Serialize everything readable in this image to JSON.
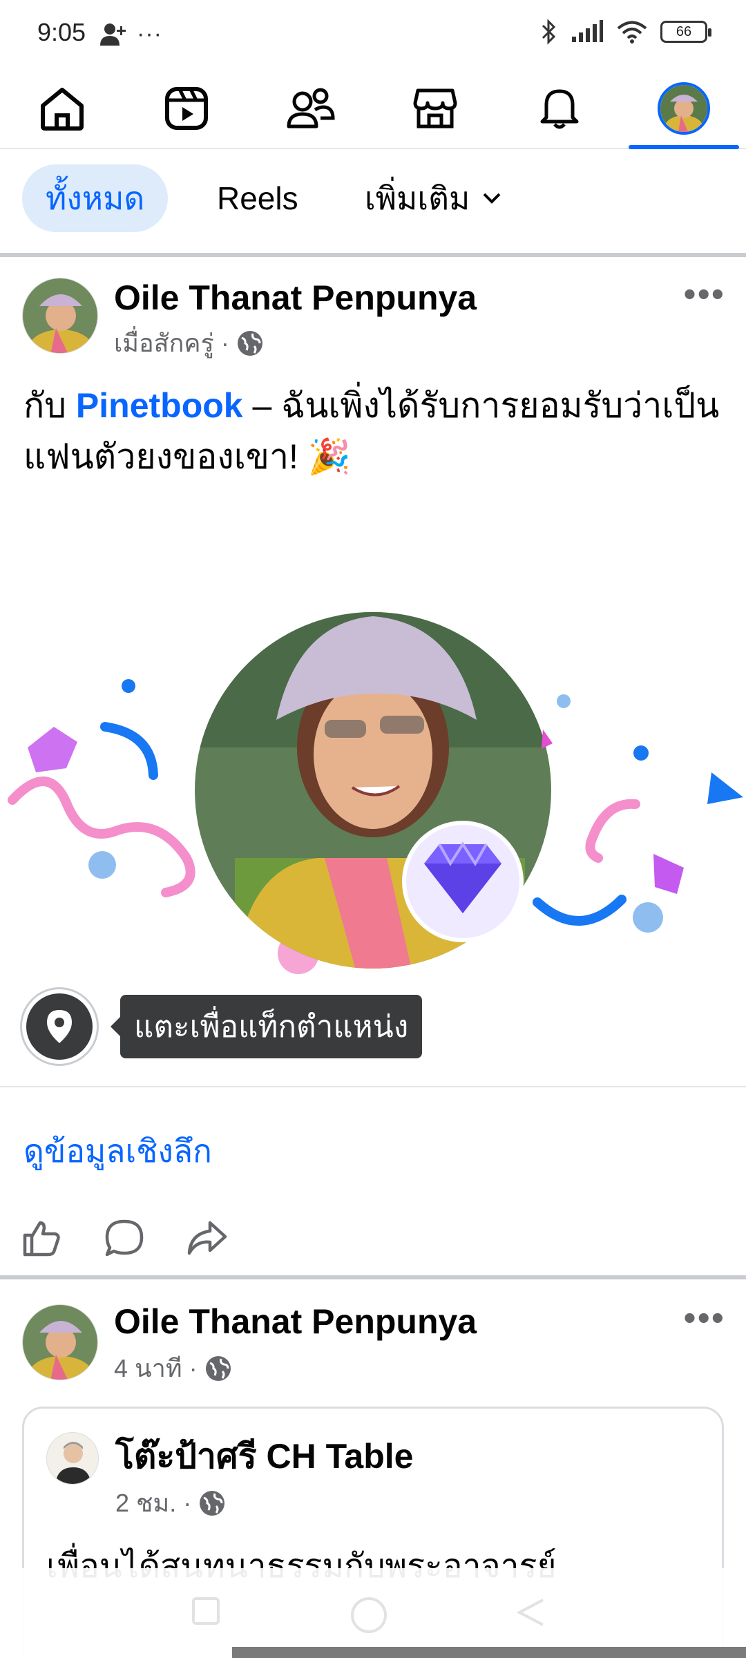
{
  "status_bar": {
    "time": "9:05",
    "battery": "66"
  },
  "top_nav": {
    "items": [
      "home-icon",
      "reels-icon",
      "friends-icon",
      "marketplace-icon",
      "notifications-icon",
      "profile-avatar"
    ],
    "active_index": 5
  },
  "filters": {
    "chips": [
      {
        "label": "ทั้งหมด",
        "selected": true
      },
      {
        "label": "Reels",
        "selected": false
      },
      {
        "label": "เพิ่มเติม",
        "selected": false
      }
    ]
  },
  "post1": {
    "author": "Oile Thanat Penpunya",
    "time": "เมื่อสักครู่",
    "separator": "·",
    "text_prefix": "กับ ",
    "text_link": "Pinetbook",
    "text_suffix": " – ฉันเพิ่งได้รับการยอมรับว่าเป็นแฟนตัวยงของเขา! 🎉",
    "location_tooltip": "แตะเพื่อแท็กตำแหน่ง",
    "insights_link": "ดูข้อมูลเชิงลึก"
  },
  "post2": {
    "author": "Oile Thanat Penpunya",
    "time": "4 นาที",
    "separator": "·",
    "shared": {
      "author": "โต๊ะป้าศรี  CH Table",
      "time": "2 ชม.",
      "separator": "·",
      "text": "เพื่อนได้สนทนาธรรมกับพระอาจารย์"
    }
  },
  "colors": {
    "accent": "#0866ff",
    "chip_bg": "#ddebfb",
    "secondary_text": "#65676b"
  }
}
